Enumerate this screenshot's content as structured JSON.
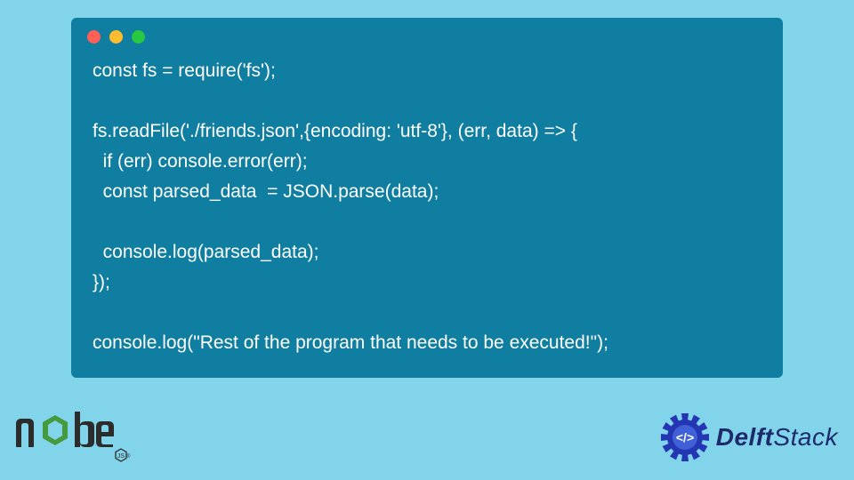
{
  "code_lines": [
    "const fs = require('fs');",
    "",
    "fs.readFile('./friends.json',{encoding: 'utf-8'}, (err, data) => {",
    "  if (err) console.error(err);",
    "  const parsed_data  = JSON.parse(data);",
    "",
    "  console.log(parsed_data);",
    "});",
    "",
    "console.log(\"Rest of the program that needs to be executed!\");"
  ],
  "brand_left": "node",
  "brand_right_bold": "Delft",
  "brand_right_rest": "Stack",
  "colors": {
    "page_bg": "#81d4ea",
    "window_bg": "#0f7ea0",
    "code_fg": "#ffffff",
    "dot_red": "#ff5f57",
    "dot_yellow": "#febc2e",
    "dot_green": "#28c840",
    "node_green": "#44883e",
    "delft_blue": "#1d2a6b"
  }
}
